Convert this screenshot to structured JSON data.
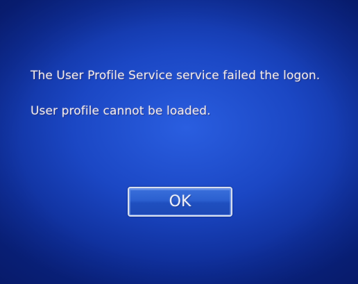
{
  "dialog": {
    "message_line1": "The User Profile Service service failed the logon.",
    "message_line2": "User profile cannot be loaded.",
    "ok_label": "OK"
  },
  "colors": {
    "background": "#1b47c4",
    "text": "#f1ecec",
    "button_border": "#d9dfee"
  }
}
